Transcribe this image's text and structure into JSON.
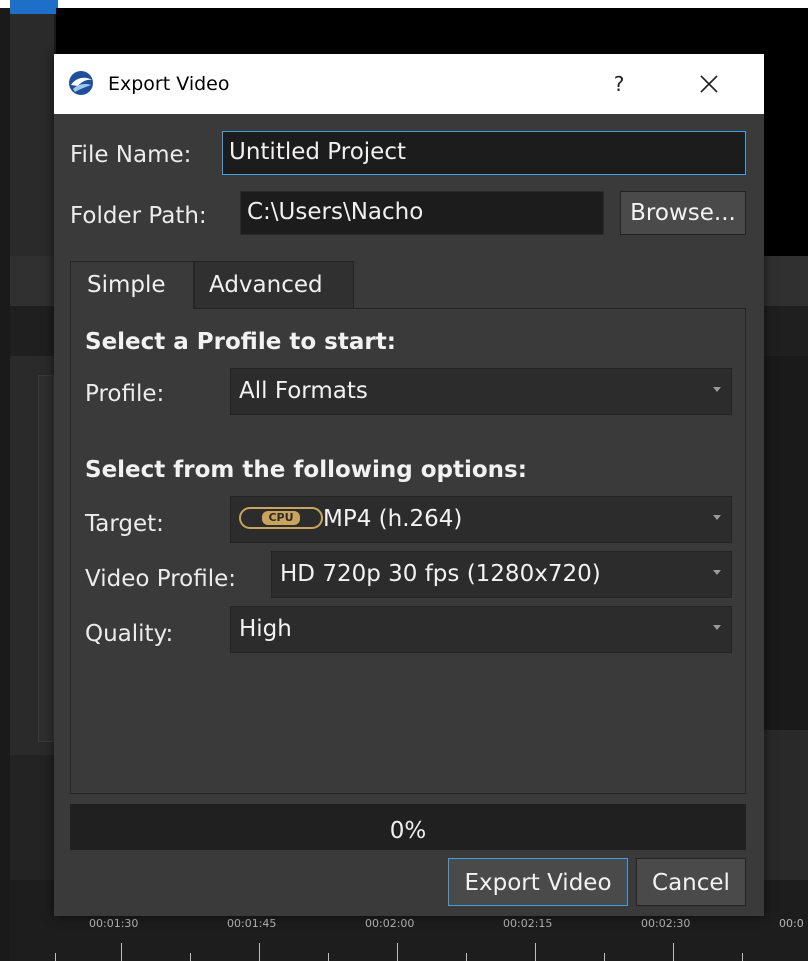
{
  "dialog": {
    "title": "Export Video",
    "help_label": "?",
    "file_name_label": "File Name:",
    "file_name_value": "Untitled Project",
    "folder_path_label": "Folder Path:",
    "folder_path_value": "C:\\Users\\Nacho",
    "browse_label": "Browse...",
    "tabs": [
      {
        "label": "Simple",
        "active": true
      },
      {
        "label": "Advanced",
        "active": false
      }
    ],
    "simple": {
      "profile_section_title": "Select a Profile to start:",
      "profile_label": "Profile:",
      "profile_value": "All Formats",
      "options_section_title": "Select from the following options:",
      "target_label": "Target:",
      "target_badge": "CPU",
      "target_value": "MP4 (h.264)",
      "video_profile_label": "Video Profile:",
      "video_profile_value": "HD 720p 30 fps (1280x720)",
      "quality_label": "Quality:",
      "quality_value": "High"
    },
    "progress_text": "0%",
    "export_label": "Export Video",
    "cancel_label": "Cancel"
  },
  "timeline": {
    "labels": [
      "00:01:30",
      "00:01:45",
      "00:02:00",
      "00:02:15",
      "00:02:30",
      "00:0"
    ]
  },
  "colors": {
    "accent": "#3ea0e0",
    "badge": "#c9a45c",
    "dialog_bg": "#3a3a3a"
  }
}
